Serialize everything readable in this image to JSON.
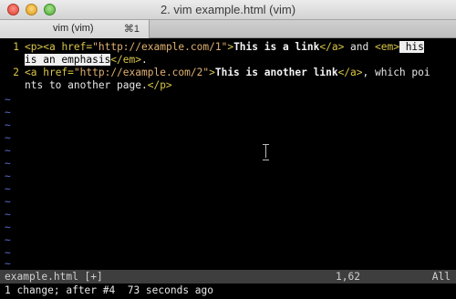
{
  "window": {
    "title": "2. vim example.html (vim)"
  },
  "tab": {
    "label": "vim (vim)",
    "shortcut": "⌘1"
  },
  "editor": {
    "line1": {
      "number": "1",
      "p_open": "<p>",
      "a_open_start": "<a ",
      "attr": "href=",
      "url": "\"http://example.com/1\"",
      "a_open_end": ">",
      "link_text": "This is a link",
      "a_close": "</a>",
      "and": " and ",
      "em_open": "<em>",
      "em_text_first": " his"
    },
    "line1_wrap": {
      "em_text_second": "is an emphasis",
      "em_close": "</em>",
      "period": "."
    },
    "line2": {
      "number": "2",
      "a_open_start": "<a ",
      "attr": "href=",
      "url": "\"http://example.com/2\"",
      "a_open_end": ">",
      "link_text": "This is another link",
      "a_close": "</a>",
      "trailing": ", which poi"
    },
    "line2_wrap": {
      "text": "nts to another page.",
      "p_close": "</p>"
    },
    "tilde": "~"
  },
  "status": {
    "file": "example.html [+]",
    "position": "1,62",
    "percent": "All"
  },
  "cmdline": {
    "message": "1 change; after #4  73 seconds ago"
  },
  "colors": {
    "background": "#000000",
    "tag": "#d9c548",
    "string": "#e0b070",
    "tilde": "#5c6bd0",
    "statusline": "#3e3e3e"
  }
}
